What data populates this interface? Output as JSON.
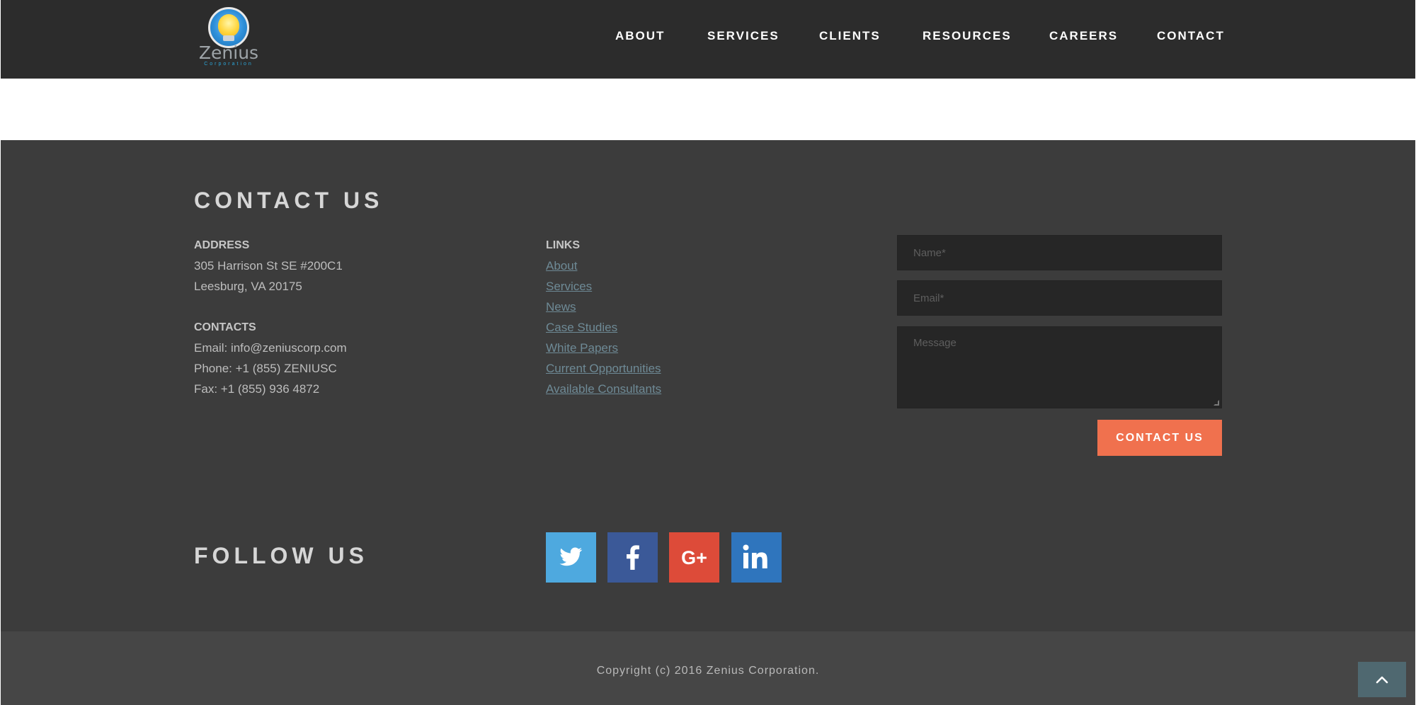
{
  "brand": {
    "name": "Zenius",
    "tagline": "Corporation"
  },
  "nav": {
    "items": [
      {
        "label": "ABOUT"
      },
      {
        "label": "SERVICES"
      },
      {
        "label": "CLIENTS"
      },
      {
        "label": "RESOURCES"
      },
      {
        "label": "CAREERS"
      },
      {
        "label": "CONTACT"
      }
    ]
  },
  "contact": {
    "title": "CONTACT US",
    "address": {
      "heading": "ADDRESS",
      "line1": "305 Harrison St SE #200C1",
      "line2": "Leesburg, VA 20175"
    },
    "contacts": {
      "heading": "CONTACTS",
      "email": "Email: info@zeniuscorp.com",
      "phone": "Phone: +1 (855) ZENIUSC",
      "fax": "Fax: +1 (855) 936 4872"
    },
    "links": {
      "heading": "LINKS",
      "items": [
        {
          "label": "About"
        },
        {
          "label": "Services"
        },
        {
          "label": "News"
        },
        {
          "label": "Case Studies"
        },
        {
          "label": "White Papers"
        },
        {
          "label": "Current Opportunities"
        },
        {
          "label": "Available Consultants"
        }
      ]
    },
    "form": {
      "name_placeholder": "Name*",
      "email_placeholder": "Email*",
      "message_placeholder": "Message",
      "submit_label": "CONTACT US"
    }
  },
  "follow": {
    "title": "FOLLOW US",
    "networks": [
      {
        "name": "twitter",
        "icon": "twitter-icon",
        "color": "#4ea9df"
      },
      {
        "name": "facebook",
        "icon": "facebook-icon",
        "color": "#3b5998"
      },
      {
        "name": "google-plus",
        "icon": "google-plus-icon",
        "color": "#dd4b39"
      },
      {
        "name": "linkedin",
        "icon": "linkedin-icon",
        "color": "#2f75bd"
      }
    ]
  },
  "footer": {
    "copyright": "Copyright (c) 2016 Zenius Corporation."
  },
  "colors": {
    "header_bg": "#2c2c2c",
    "footer_bg": "#3c3c3c",
    "bottom_bg": "#464646",
    "accent": "#f0714e",
    "link": "#6e8a96"
  }
}
